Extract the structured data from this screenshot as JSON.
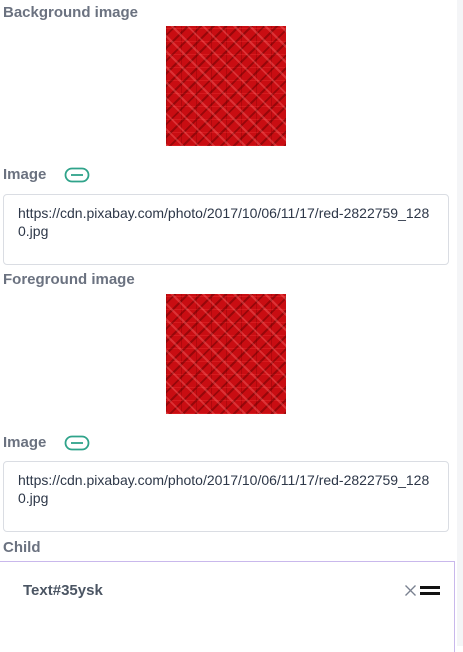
{
  "background": {
    "section_label": "Background image",
    "image_label": "Image",
    "url": "https://cdn.pixabay.com/photo/2017/10/06/11/17/red-2822759_1280.jpg"
  },
  "foreground": {
    "section_label": "Foreground image",
    "image_label": "Image",
    "url": "https://cdn.pixabay.com/photo/2017/10/06/11/17/red-2822759_1280.jpg"
  },
  "child": {
    "section_label": "Child",
    "item_label": "Text#35ysk"
  },
  "colors": {
    "accent": "#2fa38a",
    "panel_border": "#c9b8ec",
    "image_red": "#c90d12"
  },
  "icons": {
    "link": "link-icon",
    "close": "close-icon",
    "drag": "drag-handle-icon"
  }
}
